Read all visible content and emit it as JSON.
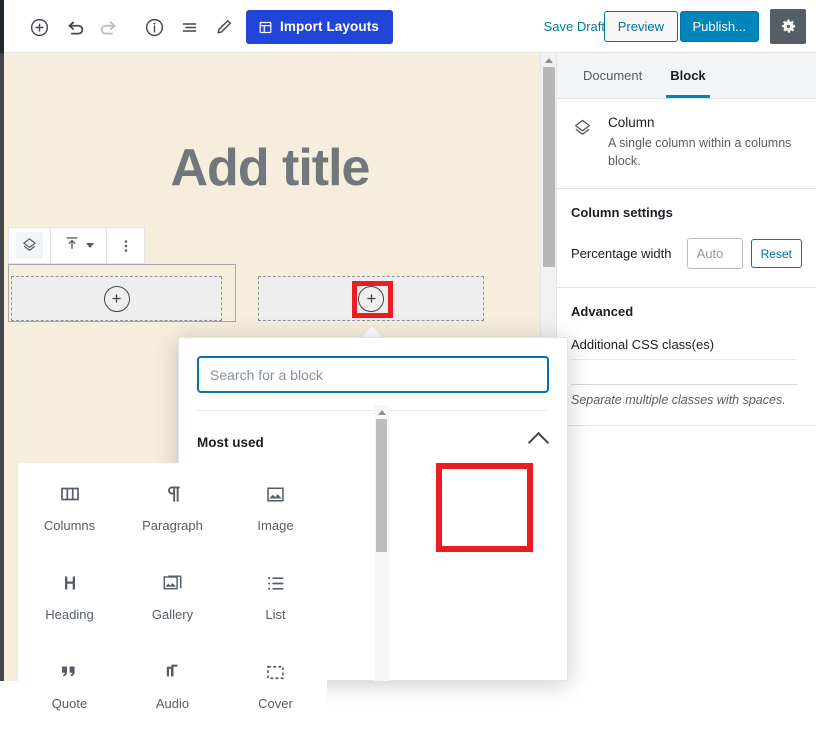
{
  "toolbar": {
    "icons": [
      {
        "name": "add-block-icon",
        "glyph": "plus-circle",
        "disabled": false
      },
      {
        "name": "undo-icon",
        "glyph": "undo",
        "disabled": false
      },
      {
        "name": "redo-icon",
        "glyph": "redo",
        "disabled": true
      },
      {
        "name": "info-icon",
        "glyph": "info-circle",
        "disabled": false
      },
      {
        "name": "block-navigation-icon",
        "glyph": "list-view",
        "disabled": false
      },
      {
        "name": "edit-pencil-icon",
        "glyph": "pencil",
        "disabled": false
      }
    ],
    "import_layouts_label": "Import Layouts",
    "save_draft_label": "Save Draft",
    "preview_label": "Preview",
    "publish_label": "Publish...",
    "settings_gear_name": "gear-icon"
  },
  "canvas": {
    "title_placeholder": "Add title",
    "background_color": "#f6eedc",
    "block_toolbar": {
      "column_icon": "column-layers-icon",
      "align_icon": "vertical-align-top-icon",
      "more_options_icon": "more-vertical-icon"
    },
    "columns": [
      {
        "name": "column-slot-1",
        "appender_label": "+",
        "selected": true
      },
      {
        "name": "column-slot-2",
        "appender_label": "+",
        "selected": false
      }
    ],
    "highlight_color": "#ec1c24"
  },
  "sidebar": {
    "tabs": [
      {
        "label": "Document",
        "active": false
      },
      {
        "label": "Block",
        "active": true
      }
    ],
    "block_card": {
      "icon": "column-layers-icon",
      "title": "Column",
      "description": "A single column within a columns block."
    },
    "column_settings": {
      "panel_title": "Column settings",
      "percentage_width_label": "Percentage width",
      "width_value": "",
      "width_placeholder": "Auto",
      "reset_label": "Reset"
    },
    "advanced": {
      "panel_title": "Advanced",
      "css_label": "Additional CSS class(es)",
      "css_value": "",
      "help_text": "Separate multiple classes with spaces."
    },
    "accent_color": "#0085ba"
  },
  "inserter": {
    "search_placeholder": "Search for a block",
    "search_value": "",
    "section_label": "Most used",
    "section_collapse_icon": "chevron-up-icon",
    "blocks": [
      {
        "label": "Columns",
        "icon": "columns-icon",
        "highlighted": false
      },
      {
        "label": "Paragraph",
        "icon": "pilcrow-icon",
        "highlighted": false
      },
      {
        "label": "Image",
        "icon": "image-icon",
        "highlighted": true
      },
      {
        "label": "Heading",
        "icon": "heading-h-icon",
        "highlighted": false
      },
      {
        "label": "Gallery",
        "icon": "gallery-icon",
        "highlighted": false
      },
      {
        "label": "List",
        "icon": "bullet-list-icon",
        "highlighted": false
      },
      {
        "label": "Quote",
        "icon": "quote-icon",
        "highlighted": false
      },
      {
        "label": "Audio",
        "icon": "audio-note-icon",
        "highlighted": false
      },
      {
        "label": "Cover",
        "icon": "cover-frame-icon",
        "highlighted": false
      }
    ]
  }
}
